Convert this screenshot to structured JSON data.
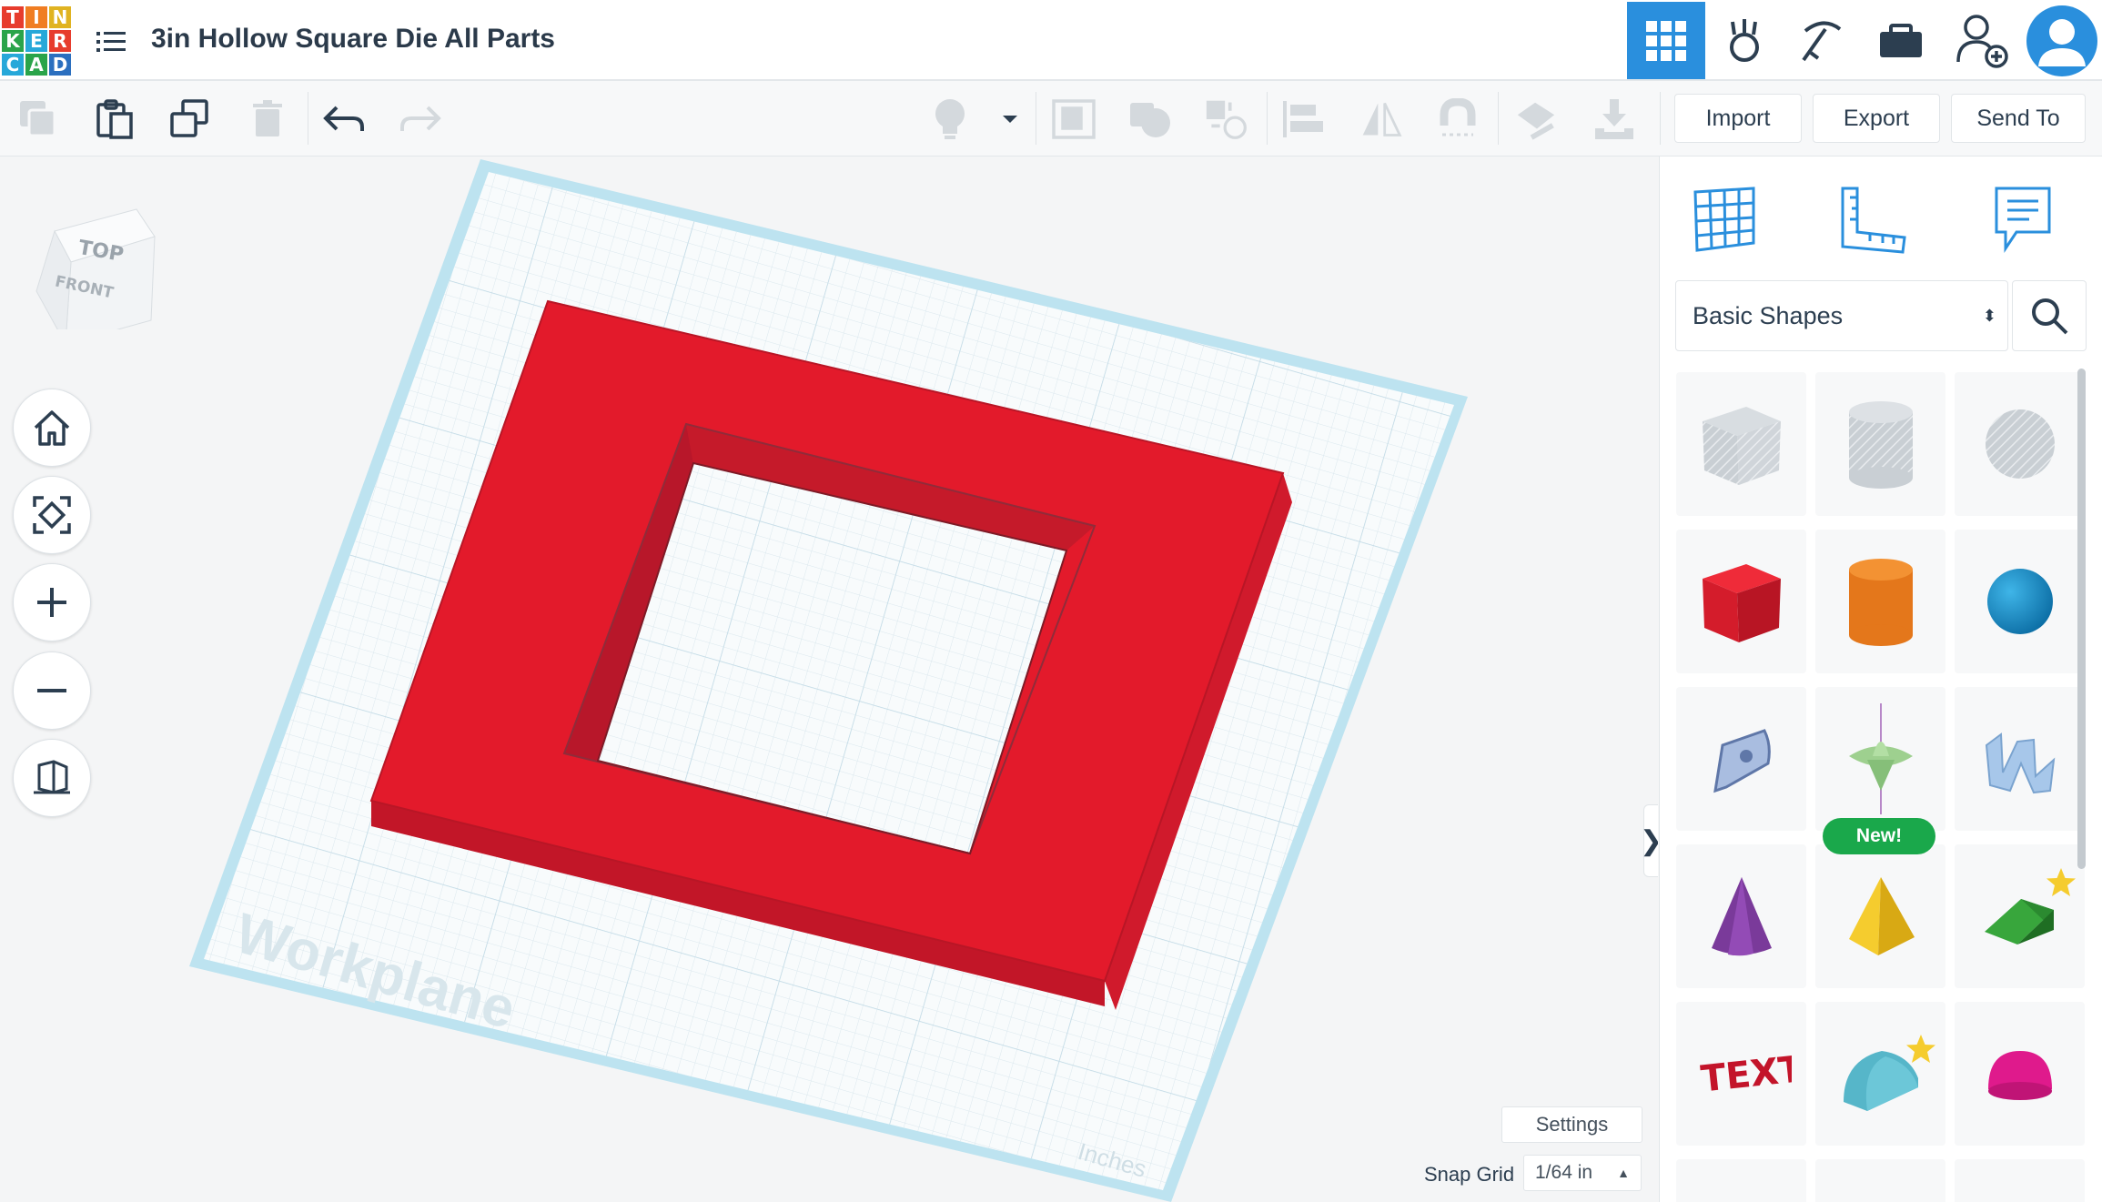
{
  "logo": {
    "letters": [
      "T",
      "I",
      "N",
      "K",
      "E",
      "R",
      "C",
      "A",
      "D"
    ],
    "colors": [
      "#e73c2d",
      "#f07d22",
      "#f7c83a",
      "#2aa44a",
      "#27a8d9",
      "#e73c2d",
      "#27a8d9",
      "#2aa44a",
      "#2b6fbf"
    ]
  },
  "header": {
    "title": "3in Hollow Square Die All Parts"
  },
  "toolbar": {
    "import_label": "Import",
    "export_label": "Export",
    "send_to_label": "Send To"
  },
  "viewcube": {
    "top_label": "TOP",
    "front_label": "FRONT"
  },
  "workplane": {
    "label": "Workplane",
    "units": "Inches",
    "plate_color": "#e31a2b"
  },
  "bottom": {
    "settings_label": "Settings",
    "snap_label": "Snap Grid",
    "snap_value": "1/64 in"
  },
  "panel": {
    "category": "Basic Shapes",
    "shapes": [
      {
        "name": "Box Hole"
      },
      {
        "name": "Cylinder Hole"
      },
      {
        "name": "Sphere Hole"
      },
      {
        "name": "Box"
      },
      {
        "name": "Cylinder"
      },
      {
        "name": "Sphere"
      },
      {
        "name": "Scribble"
      },
      {
        "name": "Spinning Top",
        "badge": "New!"
      },
      {
        "name": "Shape Generator"
      },
      {
        "name": "Cone"
      },
      {
        "name": "Pyramid"
      },
      {
        "name": "Wedge"
      },
      {
        "name": "Text"
      },
      {
        "name": "Half Cylinder"
      },
      {
        "name": "Half Sphere"
      }
    ]
  },
  "colors": {
    "accent": "#2a8fdd",
    "red": "#e31a2b",
    "grid_edge": "#bde3f0"
  }
}
